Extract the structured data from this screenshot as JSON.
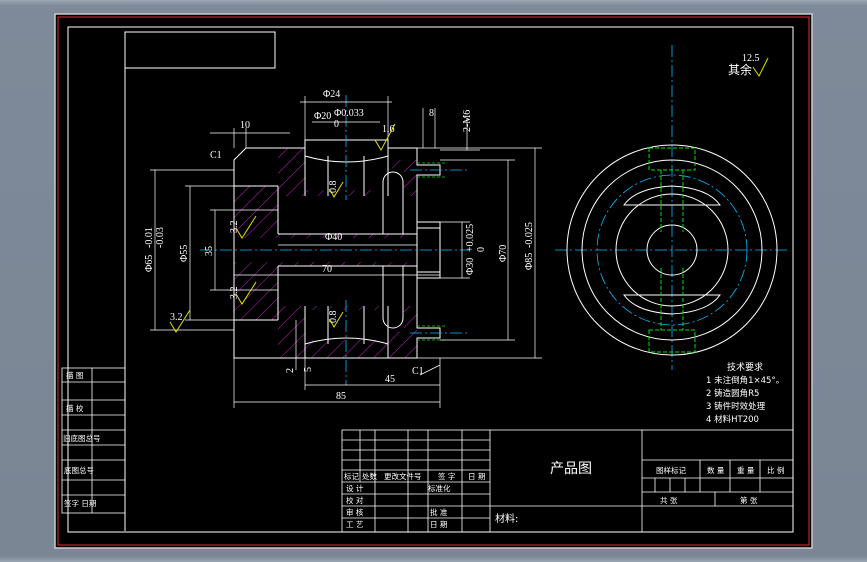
{
  "roughness": {
    "label": "其余",
    "value": "12.5"
  },
  "main_view": {
    "dims": {
      "d24": "Φ24",
      "d20": "Φ20",
      "d20_tol": "Φ0.033\n0",
      "d8": "8",
      "dM6": "2-M6",
      "d10": "10",
      "d1_6_top": "1.6",
      "c1_top": "C1",
      "d3_2_left_mid": "3.2",
      "d3_2_left_low": "3.2",
      "d3_2_left_bot": "3.2",
      "d0_8_top": "0.8",
      "d0_8_bot": "0.8",
      "d40": "Φ40",
      "d70_h": "70",
      "d_phi65": "Φ65",
      "d_phi65_tol": "-0.01\n-0.03",
      "d_phi55": "Φ55",
      "d35": "35",
      "d_phi30": "Φ30",
      "d_phi30_tol": "+0.025\n0",
      "d_phi70": "Φ70",
      "d_phi85": "Φ85",
      "d_phi85_tol": "-0.025",
      "d5": "5",
      "d2": "2",
      "d45": "45",
      "c1_bot": "C1",
      "d85": "85"
    }
  },
  "tech_req": {
    "title": "技术要求",
    "items": [
      "1 未注倒角1×45°。",
      "2 铸造圆角R5",
      "3 铸件时效处理",
      "4 材料HT200"
    ]
  },
  "side_table": {
    "rows": [
      "描 图",
      "描 校",
      "旧底图总号",
      "底图总号",
      "签字  日期"
    ]
  },
  "title_block": {
    "drawing_name": "产品图",
    "material": "材料:",
    "header_cells": [
      "标记",
      "处数",
      "更改文件号",
      "签 字",
      "日 期"
    ],
    "left_rows": [
      [
        "设 计",
        "",
        "标准化",
        ""
      ],
      [
        "校 对",
        "",
        "",
        ""
      ],
      [
        "审 核",
        "",
        "批 准",
        ""
      ],
      [
        "工 艺",
        "",
        "日 期",
        ""
      ]
    ],
    "right_header": [
      "图样标记",
      "数 量",
      "重 量",
      "比 例"
    ],
    "sheet": [
      "共  张",
      "第  张"
    ]
  }
}
